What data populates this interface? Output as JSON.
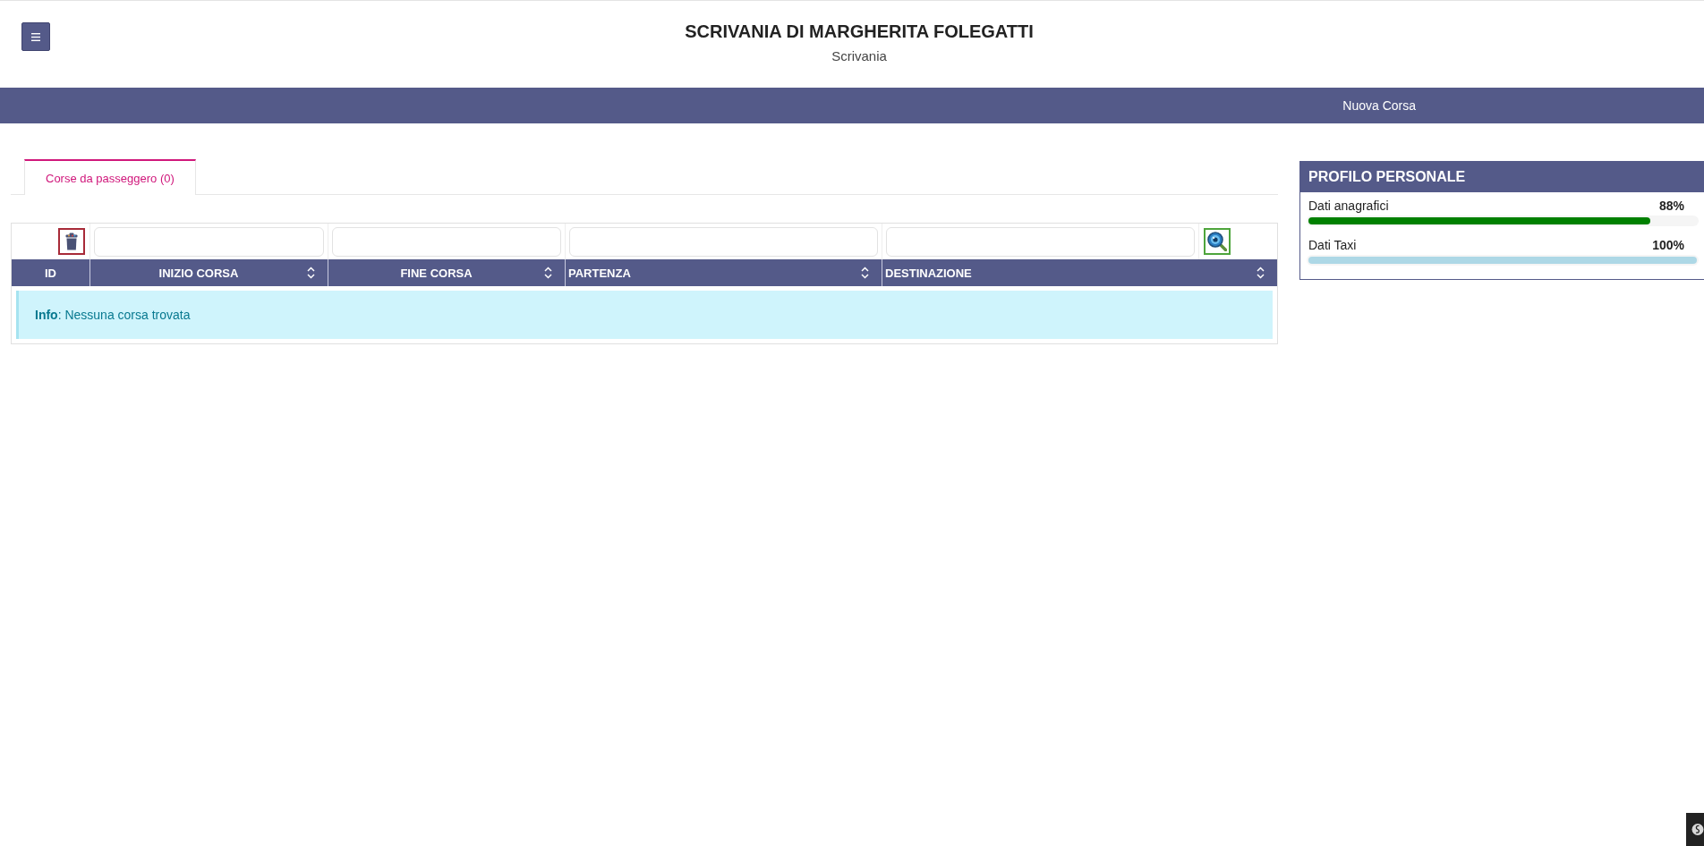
{
  "header": {
    "title": "SCRIVANIA DI MARGHERITA FOLEGATTI",
    "subtitle": "Scrivania"
  },
  "navbar": {
    "links": [
      "Nuova Corsa"
    ]
  },
  "tabs": [
    {
      "label": "Corse da passeggero (0)",
      "selected": true
    }
  ],
  "table": {
    "columns": [
      {
        "label": "ID",
        "kind": "id",
        "sortable": false
      },
      {
        "label": "INIZIO CORSA",
        "kind": "date",
        "sortable": true
      },
      {
        "label": "FINE CORSA",
        "kind": "date",
        "sortable": true
      },
      {
        "label": "PARTENZA",
        "kind": "text",
        "sortable": true
      },
      {
        "label": "DESTINAZIONE",
        "kind": "text",
        "sortable": true
      }
    ],
    "message": {
      "kind": "info",
      "text": "**Info**: Nessuna corsa trovata"
    }
  },
  "profile": {
    "title": "PROFILO PERSONALE",
    "items": [
      {
        "label": "Dati anagrafici",
        "reading": "88%",
        "level": 0.88,
        "color": "#008000"
      },
      {
        "label": "Dati Taxi",
        "reading": "100%",
        "level": 1,
        "color": "#add8e6"
      }
    ]
  }
}
